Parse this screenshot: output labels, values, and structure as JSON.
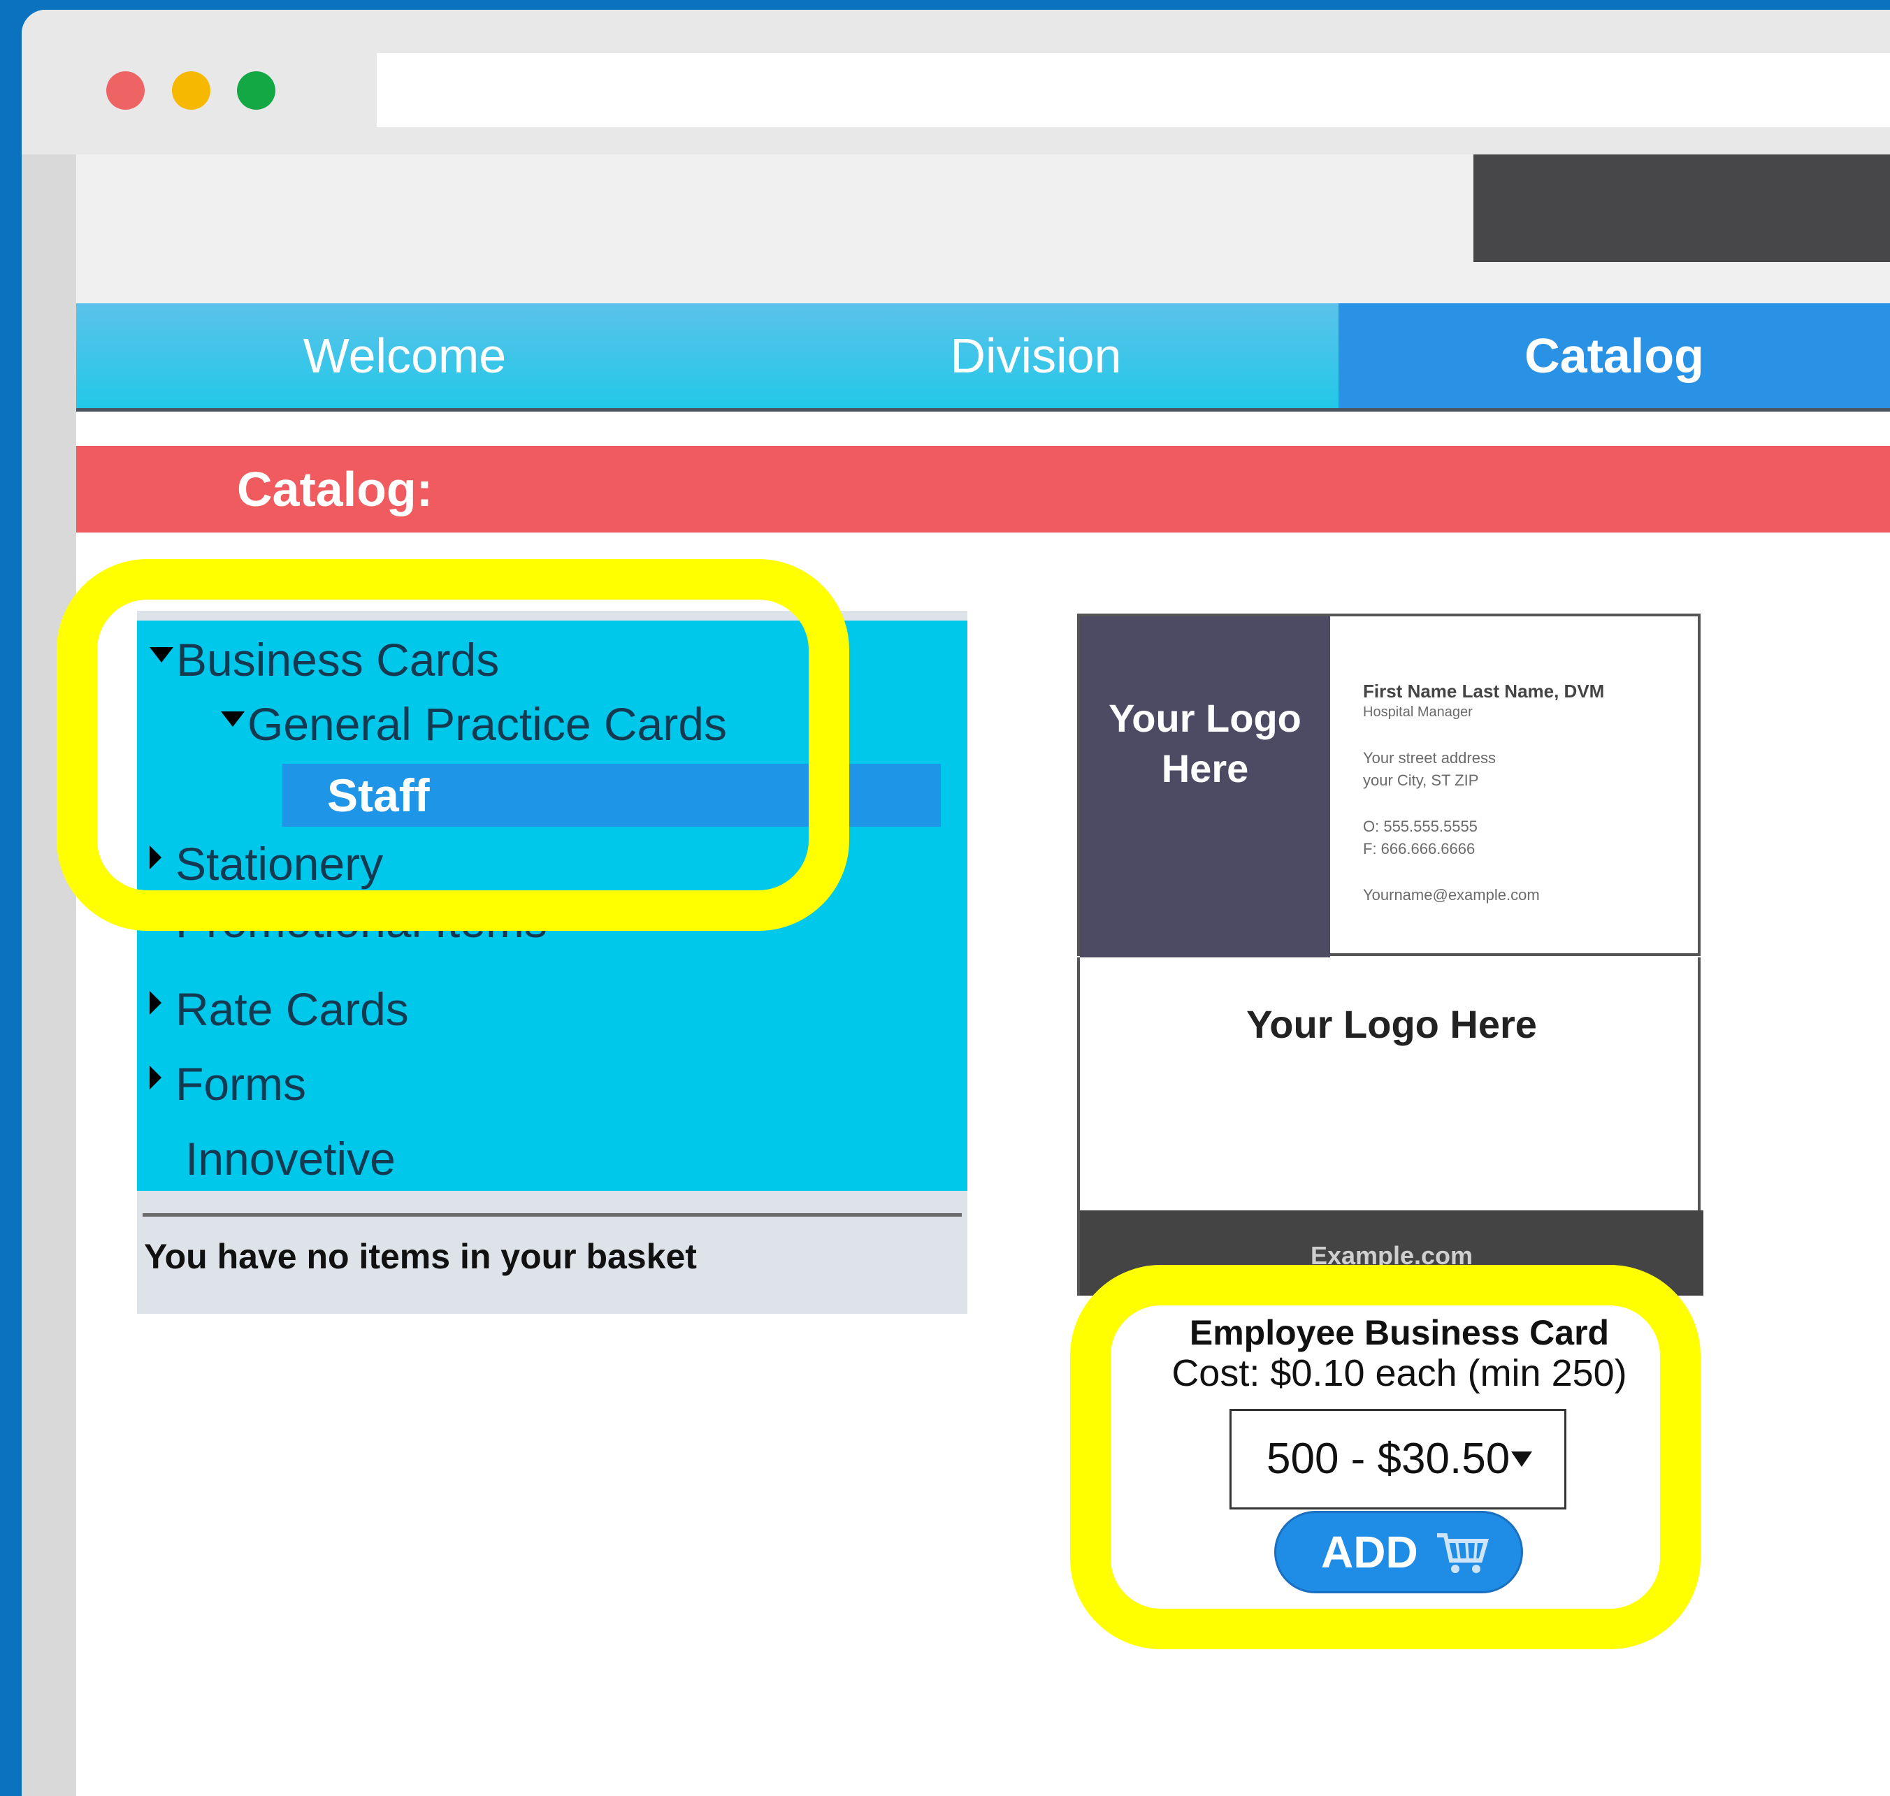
{
  "browser": {
    "traffic_lights": [
      {
        "name": "close",
        "color": "#ee6464"
      },
      {
        "name": "minimize",
        "color": "#f6b800"
      },
      {
        "name": "maximize",
        "color": "#13a844"
      }
    ],
    "address_value": ""
  },
  "nav": {
    "tabs": [
      {
        "label": "Welcome",
        "active": false
      },
      {
        "label": "Division",
        "active": false
      },
      {
        "label": "Catalog",
        "active": true
      }
    ]
  },
  "catalog": {
    "heading": "Catalog:",
    "menu": [
      {
        "label": "Business Cards",
        "state": "expanded"
      },
      {
        "label": "General Practice Cards",
        "state": "expanded"
      },
      {
        "label": "Staff",
        "state": "selected"
      },
      {
        "label": "Stationery",
        "state": "collapsed"
      },
      {
        "label": "Promotional Items",
        "state": "collapsed"
      },
      {
        "label": "Rate Cards",
        "state": "collapsed"
      },
      {
        "label": "Forms",
        "state": "collapsed"
      },
      {
        "label": "Innovetive",
        "state": "leaf"
      }
    ],
    "basket_text": "You have no items in your basket"
  },
  "product": {
    "card_front": {
      "logo_text": "Your Logo Here",
      "name": "First Name Last Name, DVM",
      "role": "Hospital Manager",
      "address_line1": "Your street address",
      "address_line2": "your City, ST ZIP",
      "office_phone": "O: 555.555.5555",
      "fax": "F: 666.666.6666",
      "email": "Yourname@example.com"
    },
    "card_back": {
      "logo_text": "Your Logo Here",
      "url": "Example.com"
    },
    "title": "Employee Business Card",
    "cost": "Cost: $0.10 each (min 250)",
    "quantity_selected": "500 - $30.50",
    "add_label": "ADD",
    "cart_icon": "shopping-cart-icon"
  },
  "colors": {
    "highlight": "#ffff00",
    "catalog_bar": "#ef5b5e",
    "nav_active": "#2a92e4",
    "menu_bg": "#00c8ea"
  }
}
